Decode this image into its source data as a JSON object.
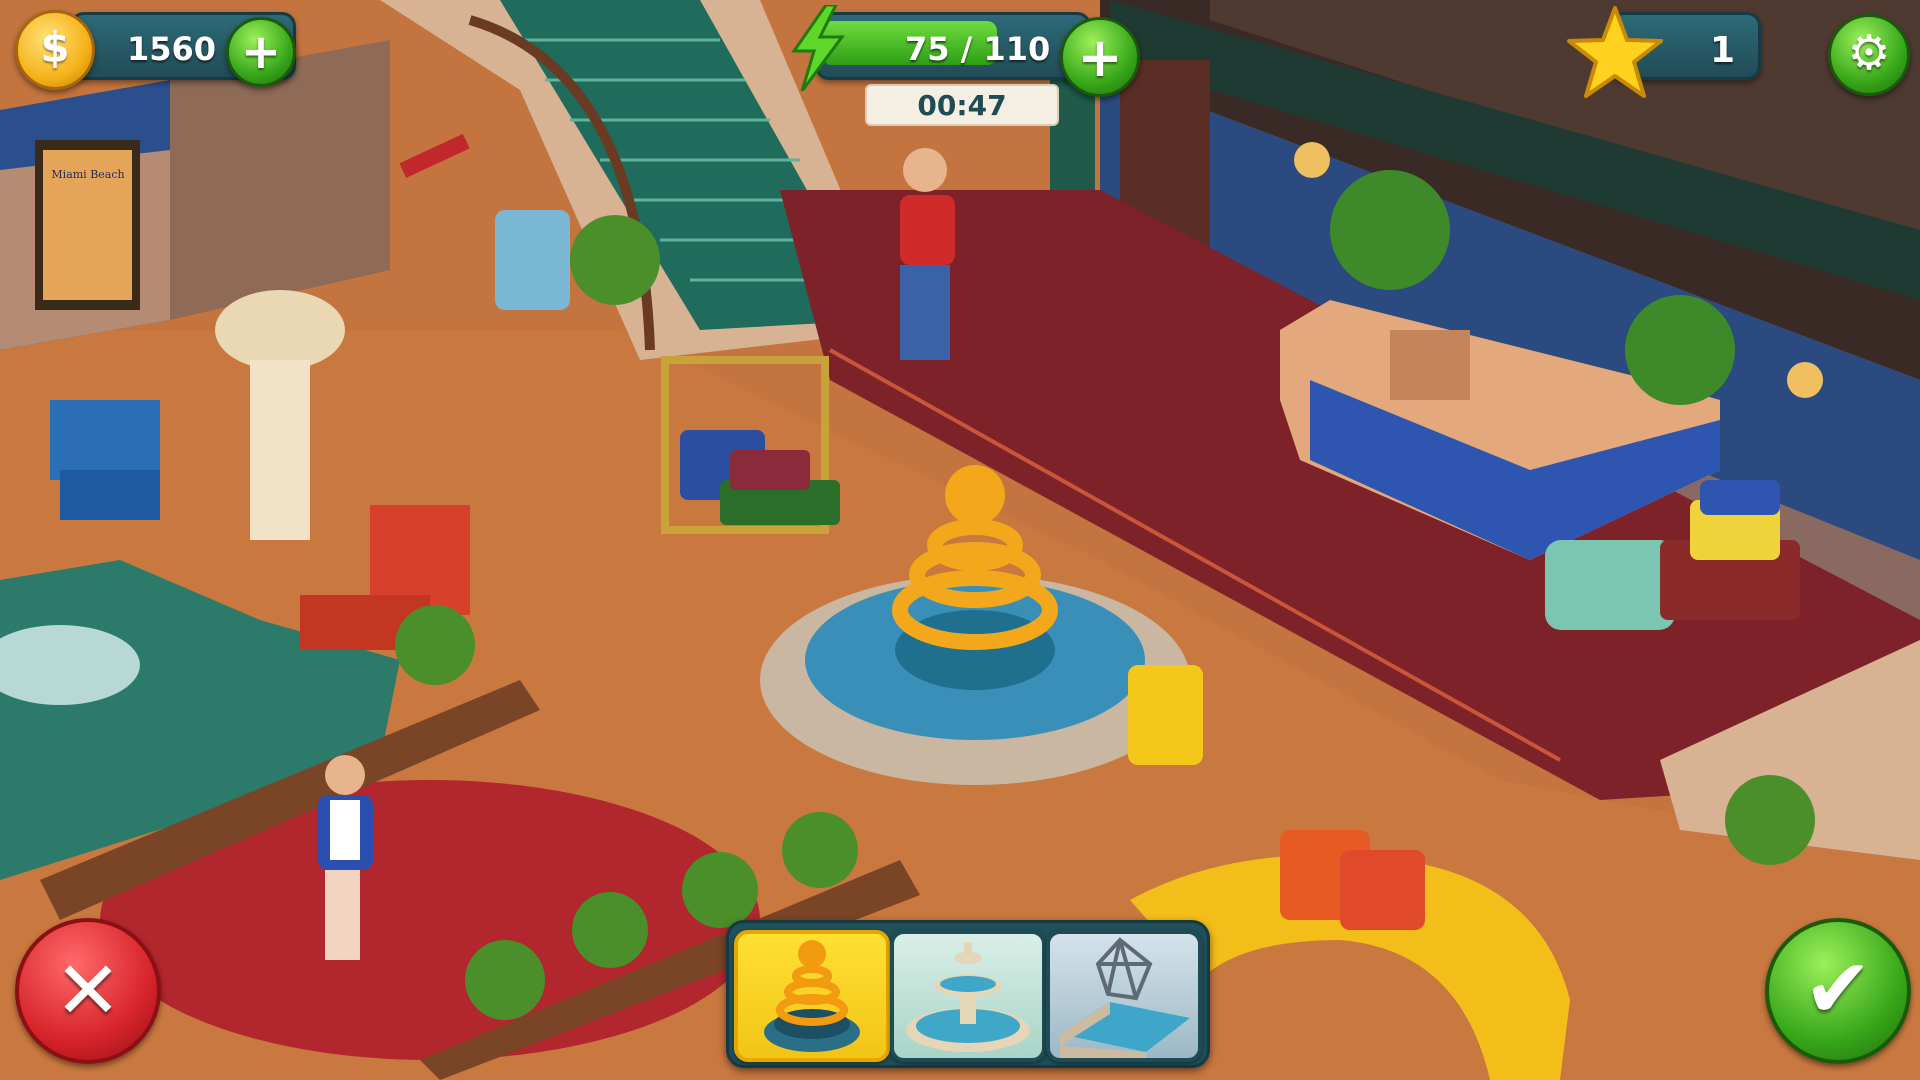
{
  "hud": {
    "coins": {
      "value": "1560",
      "icon": "dollar-coin-icon"
    },
    "energy": {
      "value": "75 / 110",
      "current": 75,
      "max": 110,
      "timer": "00:47",
      "icon": "lightning-icon"
    },
    "stars": {
      "value": "1",
      "icon": "star-icon"
    },
    "settings_icon": "gear-icon"
  },
  "scene": {
    "poster_text": "Miami Beach"
  },
  "decor_options": [
    {
      "name": "golden-rings-fountain",
      "selected": true
    },
    {
      "name": "tiered-fountain",
      "selected": false
    },
    {
      "name": "geometric-sculpture-fountain",
      "selected": false
    }
  ],
  "actions": {
    "cancel_icon": "close-icon",
    "confirm_icon": "checkmark-icon"
  },
  "colors": {
    "hud_panel": "#2e6a78",
    "energy_green": "#3fbf22",
    "coin_gold": "#f6b21a",
    "cancel_red": "#d8242b",
    "confirm_green": "#3cb01c"
  }
}
